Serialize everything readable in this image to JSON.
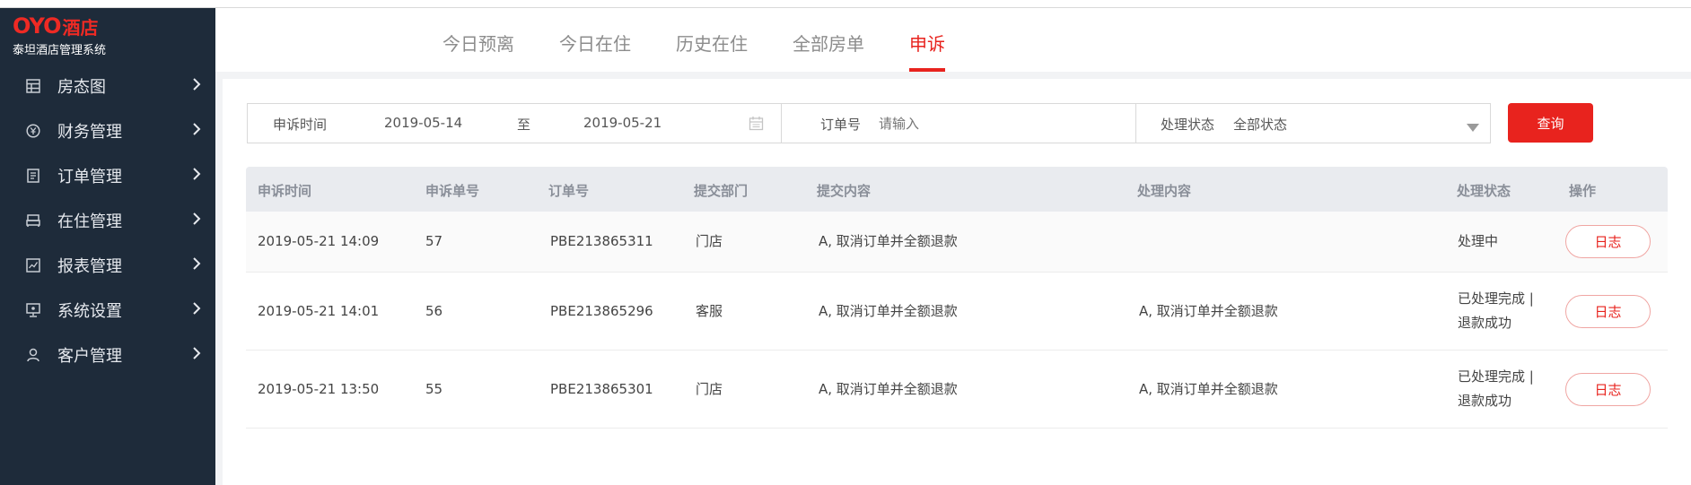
{
  "brand": {
    "logo": "OYO",
    "logo_suffix": "酒店",
    "subtitle": "泰坦酒店管理系统",
    "color": "#ee2a24"
  },
  "sidebar": {
    "items": [
      {
        "label": "房态图",
        "icon": "room-grid-icon"
      },
      {
        "label": "财务管理",
        "icon": "yuan-coin-icon"
      },
      {
        "label": "订单管理",
        "icon": "order-list-icon"
      },
      {
        "label": "在住管理",
        "icon": "bed-icon"
      },
      {
        "label": "报表管理",
        "icon": "report-chart-icon"
      },
      {
        "label": "系统设置",
        "icon": "monitor-settings-icon"
      },
      {
        "label": "客户管理",
        "icon": "user-icon"
      }
    ]
  },
  "tabs": [
    {
      "label": "今日预离",
      "active": false
    },
    {
      "label": "今日在住",
      "active": false
    },
    {
      "label": "历史在住",
      "active": false
    },
    {
      "label": "全部房单",
      "active": false
    },
    {
      "label": "申诉",
      "active": true
    }
  ],
  "filters": {
    "appeal_time_label": "申诉时间",
    "date_from": "2019-05-14",
    "date_to_sep": "至",
    "date_to": "2019-05-21",
    "order_no_label": "订单号",
    "order_no_placeholder": "请输入",
    "status_label": "处理状态",
    "status_value": "全部状态",
    "query_button": "查询"
  },
  "table": {
    "columns": [
      "申诉时间",
      "申诉单号",
      "订单号",
      "提交部门",
      "提交内容",
      "处理内容",
      "处理状态",
      "操作"
    ],
    "rows": [
      {
        "time": "2019-05-21 14:09",
        "appeal_no": "57",
        "order_no": "PBE213865311",
        "dept": "门店",
        "content": "A, 取消订单并全额退款",
        "handle": "",
        "status_line1": "处理中",
        "status_line2": "",
        "action": "日志"
      },
      {
        "time": "2019-05-21 14:01",
        "appeal_no": "56",
        "order_no": "PBE213865296",
        "dept": "客服",
        "content": "A, 取消订单并全额退款",
        "handle": "A, 取消订单并全额退款",
        "status_line1": "已处理完成 |",
        "status_line2": "退款成功",
        "action": "日志"
      },
      {
        "time": "2019-05-21 13:50",
        "appeal_no": "55",
        "order_no": "PBE213865301",
        "dept": "门店",
        "content": "A, 取消订单并全额退款",
        "handle": "A, 取消订单并全额退款",
        "status_line1": "已处理完成 |",
        "status_line2": "退款成功",
        "action": "日志"
      }
    ]
  },
  "colors": {
    "accent": "#e8231e",
    "sidebar_bg": "#1e2b3a"
  }
}
